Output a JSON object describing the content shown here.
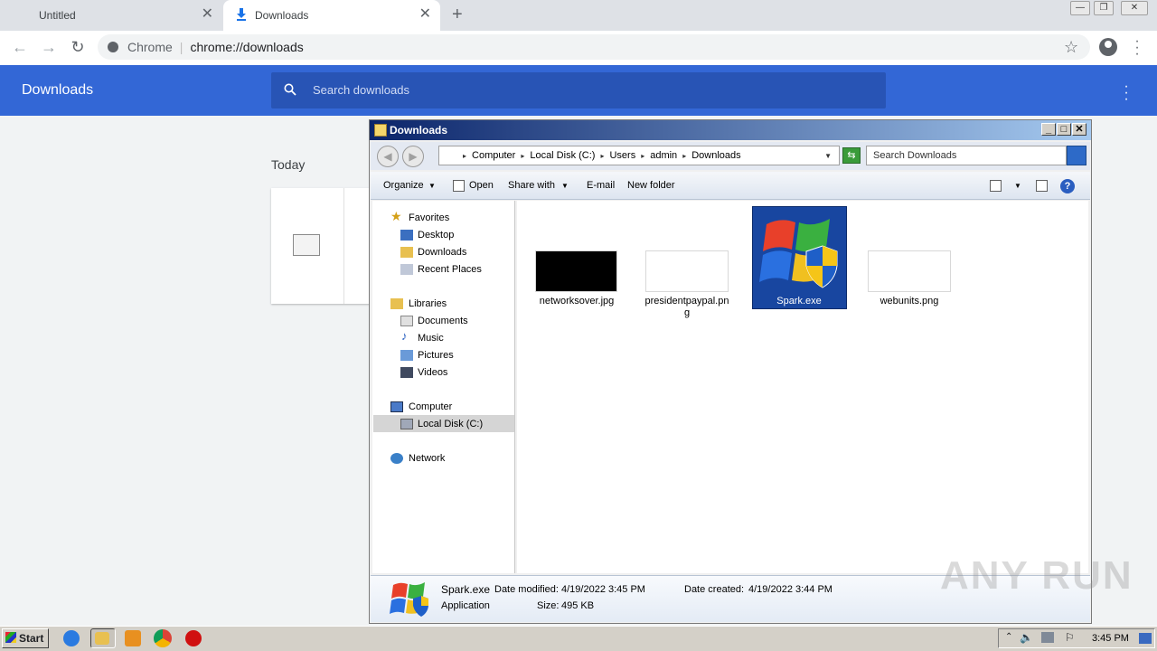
{
  "chrome": {
    "tabs": [
      {
        "label": "Untitled"
      },
      {
        "label": "Downloads"
      }
    ],
    "omnibox": {
      "site": "Chrome",
      "url": "chrome://downloads"
    },
    "icons": {
      "back": "arrow-left-icon",
      "forward": "arrow-right-icon",
      "reload": "reload-icon",
      "star": "star-icon",
      "profile": "avatar-icon",
      "menu": "kebab-icon"
    }
  },
  "downloads_page": {
    "title": "Downloads",
    "search_placeholder": "Search downloads",
    "section": "Today"
  },
  "explorer": {
    "title": "Downloads",
    "breadcrumb": [
      "Computer",
      "Local Disk (C:)",
      "Users",
      "admin",
      "Downloads"
    ],
    "search_placeholder": "Search Downloads",
    "commands": {
      "organize": "Organize",
      "open": "Open",
      "share": "Share with",
      "email": "E-mail",
      "new_folder": "New folder"
    },
    "nav": {
      "favorites": "Favorites",
      "desktop": "Desktop",
      "downloads": "Downloads",
      "recent": "Recent Places",
      "libraries": "Libraries",
      "documents": "Documents",
      "music": "Music",
      "pictures": "Pictures",
      "videos": "Videos",
      "computer": "Computer",
      "local_disk": "Local Disk (C:)",
      "network": "Network"
    },
    "files": [
      {
        "name": "networksover.jpg"
      },
      {
        "name": "presidentpaypal.pn",
        "name2": "g"
      },
      {
        "name": "Spark.exe",
        "selected": true
      },
      {
        "name": "webunits.png"
      }
    ],
    "details": {
      "name": "Spark.exe",
      "type": "Application",
      "modified_label": "Date modified:",
      "modified": "4/19/2022 3:45 PM",
      "created_label": "Date created:",
      "created": "4/19/2022 3:44 PM",
      "size_label": "Size:",
      "size": "495 KB"
    }
  },
  "taskbar": {
    "start": "Start",
    "clock": "3:45 PM"
  },
  "watermark": "ANY RUN",
  "colors": {
    "chrome_blue": "#3367d6",
    "selection": "#1846a0"
  }
}
